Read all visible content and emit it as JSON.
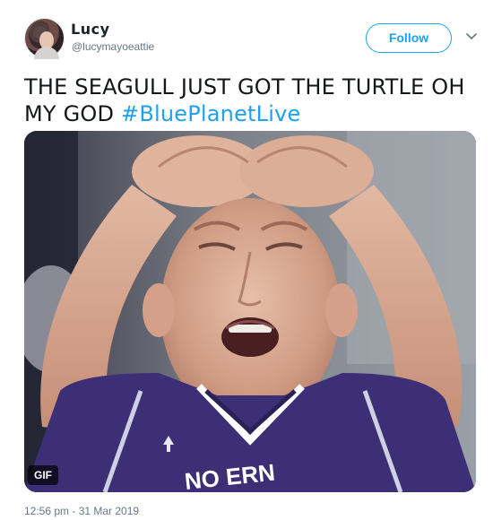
{
  "tweet": {
    "user": {
      "display_name": "Lucy",
      "handle": "@lucymayoeattie",
      "avatar_icon": "profile-photo"
    },
    "follow_label": "Follow",
    "more_icon": "chevron-down-icon",
    "text_plain": "THE SEAGULL JUST GOT THE TURTLE OH MY GOD",
    "hashtag": "#BluePlanetLive",
    "media": {
      "type": "animated-gif",
      "badge": "GIF",
      "jersey_text": "NO  ERN"
    },
    "timestamp": "12:56 pm - 31 Mar 2019"
  },
  "colors": {
    "accent": "#1da1f2",
    "text": "#14171a",
    "muted": "#657786",
    "jersey": "#3c2f75"
  }
}
